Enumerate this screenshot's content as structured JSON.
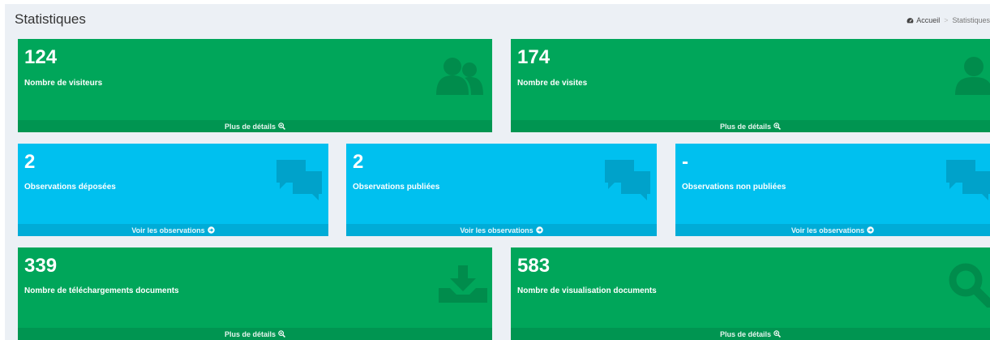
{
  "header": {
    "title": "Statistiques",
    "breadcrumb": {
      "home": "Accueil",
      "separator": ">",
      "current": "Statistiques"
    }
  },
  "colors": {
    "green": "#00a65a",
    "aqua": "#00c0ef",
    "background": "#ecf0f5"
  },
  "boxes": {
    "visitors": {
      "value": "124",
      "label": "Nombre de visiteurs",
      "footer": "Plus de détails",
      "icon": "users-icon",
      "footer_icon": "search-plus-icon"
    },
    "visits": {
      "value": "174",
      "label": "Nombre de visites",
      "footer": "Plus de détails",
      "icon": "user-icon",
      "footer_icon": "search-plus-icon"
    },
    "obs_deposited": {
      "value": "2",
      "label": "Observations déposées",
      "footer": "Voir les observations",
      "icon": "comments-icon",
      "footer_icon": "arrow-circle-right-icon"
    },
    "obs_published": {
      "value": "2",
      "label": "Observations publiées",
      "footer": "Voir les observations",
      "icon": "comments-icon",
      "footer_icon": "arrow-circle-right-icon"
    },
    "obs_unpublished": {
      "value": "-",
      "label": "Observations non publiées",
      "footer": "Voir les observations",
      "icon": "comments-icon",
      "footer_icon": "arrow-circle-right-icon"
    },
    "downloads": {
      "value": "339",
      "label": "Nombre de téléchargements documents",
      "footer": "Plus de détails",
      "icon": "download-icon",
      "footer_icon": "search-plus-icon"
    },
    "views": {
      "value": "583",
      "label": "Nombre de visualisation documents",
      "footer": "Plus de détails",
      "icon": "search-icon",
      "footer_icon": "search-plus-icon"
    }
  }
}
